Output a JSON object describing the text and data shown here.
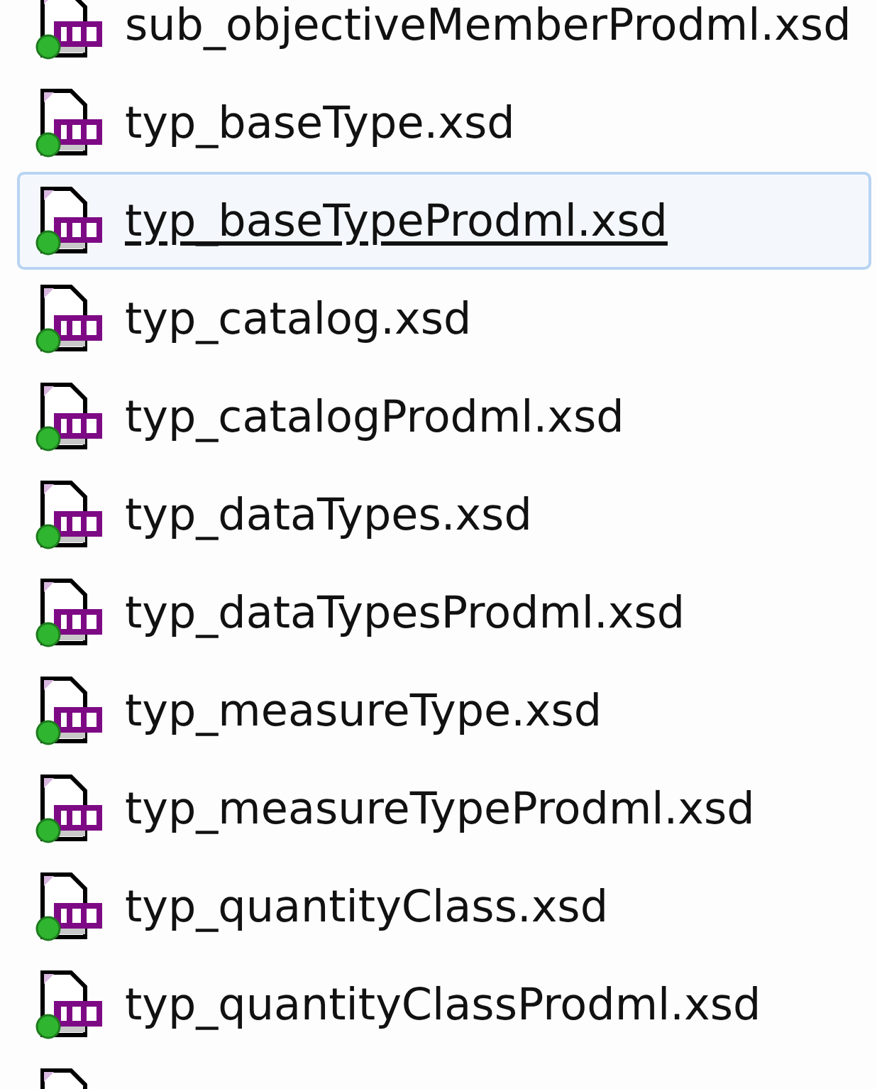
{
  "files": [
    {
      "name": "sub_objectiveMemberProdml.xsd",
      "selected": false
    },
    {
      "name": "typ_baseType.xsd",
      "selected": false
    },
    {
      "name": "typ_baseTypeProdml.xsd",
      "selected": true
    },
    {
      "name": "typ_catalog.xsd",
      "selected": false
    },
    {
      "name": "typ_catalogProdml.xsd",
      "selected": false
    },
    {
      "name": "typ_dataTypes.xsd",
      "selected": false
    },
    {
      "name": "typ_dataTypesProdml.xsd",
      "selected": false
    },
    {
      "name": "typ_measureType.xsd",
      "selected": false
    },
    {
      "name": "typ_measureTypeProdml.xsd",
      "selected": false
    },
    {
      "name": "typ_quantityClass.xsd",
      "selected": false
    },
    {
      "name": "typ_quantityClassProdml.xsd",
      "selected": false
    },
    {
      "selected": false
    }
  ]
}
